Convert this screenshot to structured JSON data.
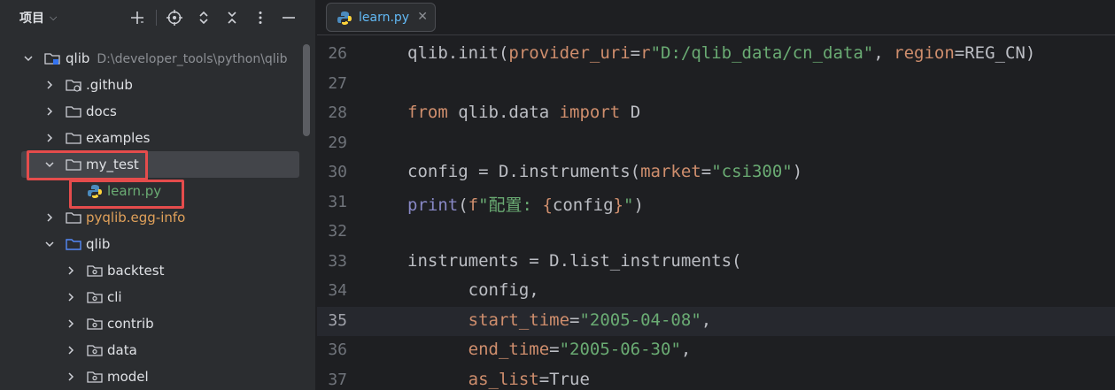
{
  "project_panel": {
    "title": "项目",
    "tree": [
      {
        "label": "qlib",
        "path": "D:\\developer_tools\\python\\qlib",
        "expanded": true,
        "icon": "module-folder-icon"
      },
      {
        "label": ".github",
        "expanded": false,
        "icon": "github-folder-icon"
      },
      {
        "label": "docs",
        "expanded": false,
        "icon": "folder-icon"
      },
      {
        "label": "examples",
        "expanded": false,
        "icon": "folder-icon"
      },
      {
        "label": "my_test",
        "expanded": true,
        "icon": "folder-icon",
        "selected": true
      },
      {
        "label": "learn.py",
        "icon": "python-file-icon"
      },
      {
        "label": "pyqlib.egg-info",
        "expanded": false,
        "icon": "folder-icon"
      },
      {
        "label": "qlib",
        "expanded": true,
        "icon": "package-folder-icon"
      },
      {
        "label": "backtest",
        "expanded": false,
        "icon": "package-folder-icon"
      },
      {
        "label": "cli",
        "expanded": false,
        "icon": "package-folder-icon"
      },
      {
        "label": "contrib",
        "expanded": false,
        "icon": "package-folder-icon"
      },
      {
        "label": "data",
        "expanded": false,
        "icon": "package-folder-icon"
      },
      {
        "label": "model",
        "expanded": false,
        "icon": "package-folder-icon"
      }
    ]
  },
  "editor": {
    "tab_label": "learn.py",
    "current_line": "35",
    "lines": [
      {
        "num": "26",
        "text": "qlib.init(provider_uri=r\"D:/qlib_data/cn_data\", region=REG_CN)"
      },
      {
        "num": "27",
        "text": ""
      },
      {
        "num": "28",
        "text": "from qlib.data import D"
      },
      {
        "num": "29",
        "text": ""
      },
      {
        "num": "30",
        "text": "config = D.instruments(market=\"csi300\")"
      },
      {
        "num": "31",
        "text": "print(f\"配置: {config}\")"
      },
      {
        "num": "32",
        "text": ""
      },
      {
        "num": "33",
        "text": "instruments = D.list_instruments("
      },
      {
        "num": "34",
        "text": "      config,"
      },
      {
        "num": "35",
        "text": "      start_time=\"2005-04-08\","
      },
      {
        "num": "36",
        "text": "      end_time=\"2005-06-30\","
      },
      {
        "num": "37",
        "text": "      as_list=True"
      }
    ]
  },
  "colors": {
    "keyword": "#cf8e6d",
    "string": "#6aab73",
    "builtin": "#8888c6",
    "tab_text": "#62b9f5",
    "highlight_box": "#e54c4c"
  }
}
